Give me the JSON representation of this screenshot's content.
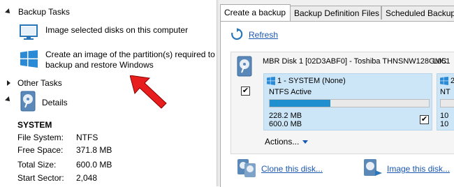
{
  "left": {
    "backup_tasks_label": "Backup Tasks",
    "tasks": [
      {
        "label": "Image selected disks on this computer",
        "icon": "monitor-icon"
      },
      {
        "label_line1": "Create an image of the partition(s) required to",
        "label_line2": "backup and restore Windows",
        "icon": "windows-logo-icon"
      }
    ],
    "other_tasks_label": "Other Tasks",
    "details_label": "Details",
    "details": {
      "name": "SYSTEM",
      "rows": [
        {
          "key": "File System:",
          "value": "NTFS"
        },
        {
          "key": "Free Space:",
          "value": "371.8 MB"
        },
        {
          "key": "Total Size:",
          "value": "600.0 MB"
        },
        {
          "key": "Start Sector:",
          "value": "2,048"
        }
      ]
    }
  },
  "tabs": [
    {
      "label": "Create a backup",
      "active": true
    },
    {
      "label": "Backup Definition Files",
      "active": false
    },
    {
      "label": "Scheduled Backup",
      "active": false
    }
  ],
  "main": {
    "refresh_label": "Refresh",
    "disk": {
      "title": "MBR Disk 1 [02D3ABF0] - Toshiba  THNSNW128GMC",
      "title_suffix": "L051",
      "partition": {
        "name": "1 - SYSTEM (None)",
        "type": "NTFS Active",
        "used": "228.2 MB",
        "total": "600.0 MB",
        "used_fraction": 0.38
      },
      "actions_label": "Actions...",
      "next_partition_label": "2",
      "next_partition_text": "NT",
      "next_partition_size1": "10",
      "next_partition_size2": "10"
    },
    "clone_label": "Clone this disk...",
    "image_label": "Image this disk..."
  },
  "colors": {
    "accent": "#1f8fd0",
    "link": "#1a57b0",
    "arrow": "#e81e1e"
  }
}
